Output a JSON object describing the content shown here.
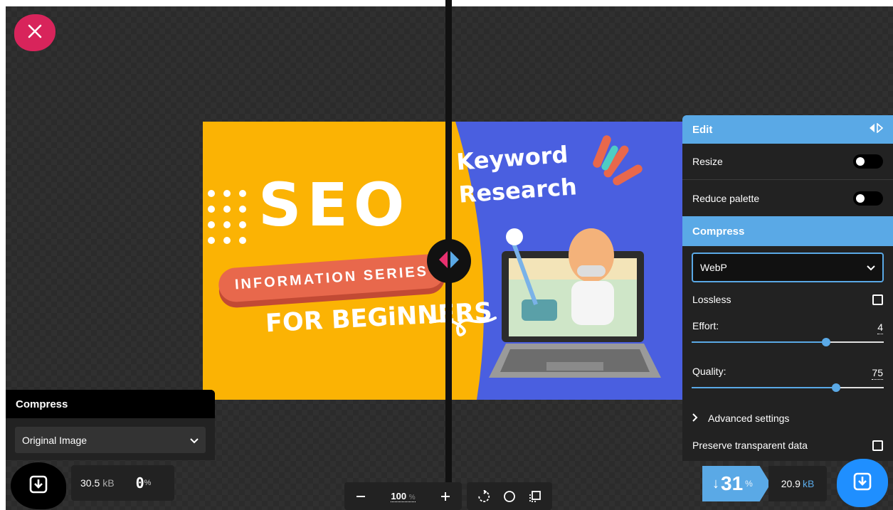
{
  "colors": {
    "accent": "#5aa9e6",
    "close": "#d8245b",
    "download_right": "#1f8fff"
  },
  "image": {
    "seo": "SEO",
    "banner": "INFORMATION SERIES",
    "beginners": "FOR BEGiNNERS",
    "keyword_line1": "Keyword",
    "keyword_line2": "Research"
  },
  "edit_panel": {
    "title": "Edit",
    "toggle_icon": "split-arrows-icon",
    "resize_label": "Resize",
    "resize_on": false,
    "reduce_palette_label": "Reduce palette",
    "reduce_palette_on": false,
    "compress_title": "Compress",
    "format_value": "WebP",
    "lossless_label": "Lossless",
    "lossless_checked": false,
    "effort_label": "Effort:",
    "effort_value": "4",
    "effort_fraction": 0.7,
    "quality_label": "Quality:",
    "quality_value": "75",
    "quality_fraction": 0.75,
    "advanced_label": "Advanced settings",
    "preserve_label": "Preserve transparent data",
    "preserve_checked": false
  },
  "left_panel": {
    "title": "Compress",
    "select_value": "Original Image"
  },
  "left_stats": {
    "size": "30.5",
    "unit": "kB",
    "percent": "0",
    "percent_sign": "%"
  },
  "zoom": {
    "value": "100",
    "unit": "%",
    "minus": "−",
    "plus": "+"
  },
  "right_stats": {
    "arrow": "↓",
    "savings": "31",
    "percent_sign": "%",
    "size": "20.9",
    "unit": "kB"
  }
}
